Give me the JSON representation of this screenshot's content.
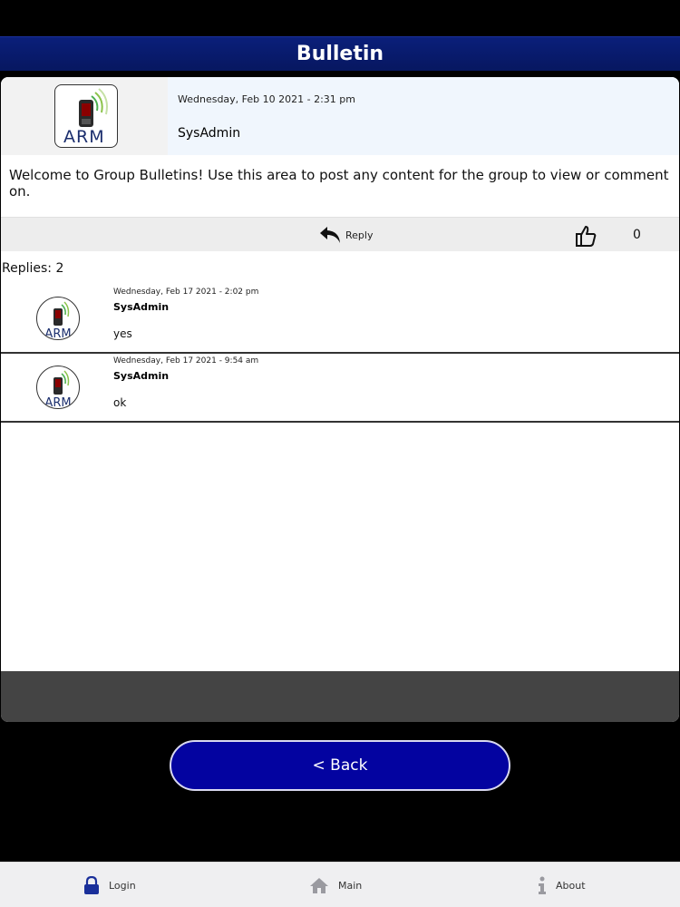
{
  "header": {
    "title": "Bulletin"
  },
  "post": {
    "logo_text": "ARM",
    "date": "Wednesday, Feb 10 2021 - 2:31 pm",
    "author": "SysAdmin",
    "body": "Welcome to Group Bulletins! Use this area to post any content for the group to view or comment on.",
    "reply_label": "Reply",
    "like_count": "0"
  },
  "replies_label": "Replies: 2",
  "replies": [
    {
      "date": "Wednesday, Feb 17 2021 - 2:02 pm",
      "author": "SysAdmin",
      "text": "yes"
    },
    {
      "date": "Wednesday, Feb 17 2021 - 9:54 am",
      "author": "SysAdmin",
      "text": "ok"
    }
  ],
  "back_label": "< Back",
  "tabs": [
    {
      "label": "Login",
      "icon": "lock-icon"
    },
    {
      "label": "Main",
      "icon": "home-icon"
    },
    {
      "label": "About",
      "icon": "info-icon"
    }
  ],
  "colors": {
    "header": "#0a1f7a",
    "button": "#0303a0",
    "tab_icon": "#1a2f9a"
  }
}
